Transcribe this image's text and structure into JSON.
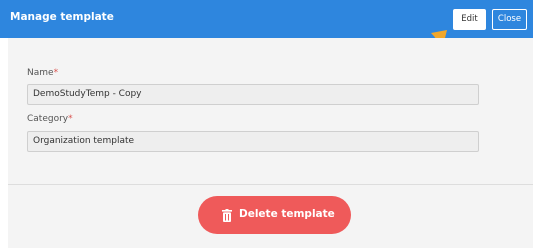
{
  "header": {
    "title": "Manage template",
    "edit_label": "Edit",
    "close_label": "Close"
  },
  "form": {
    "name_label": "Name",
    "name_value": "DemoStudyTemp - Copy",
    "category_label": "Category",
    "category_value": "Organization template",
    "required_marker": "*"
  },
  "footer": {
    "delete_label": "Delete template"
  },
  "colors": {
    "header_bg": "#2e86de",
    "delete_bg": "#ef5a5a",
    "arrow": "#f2a72a"
  }
}
